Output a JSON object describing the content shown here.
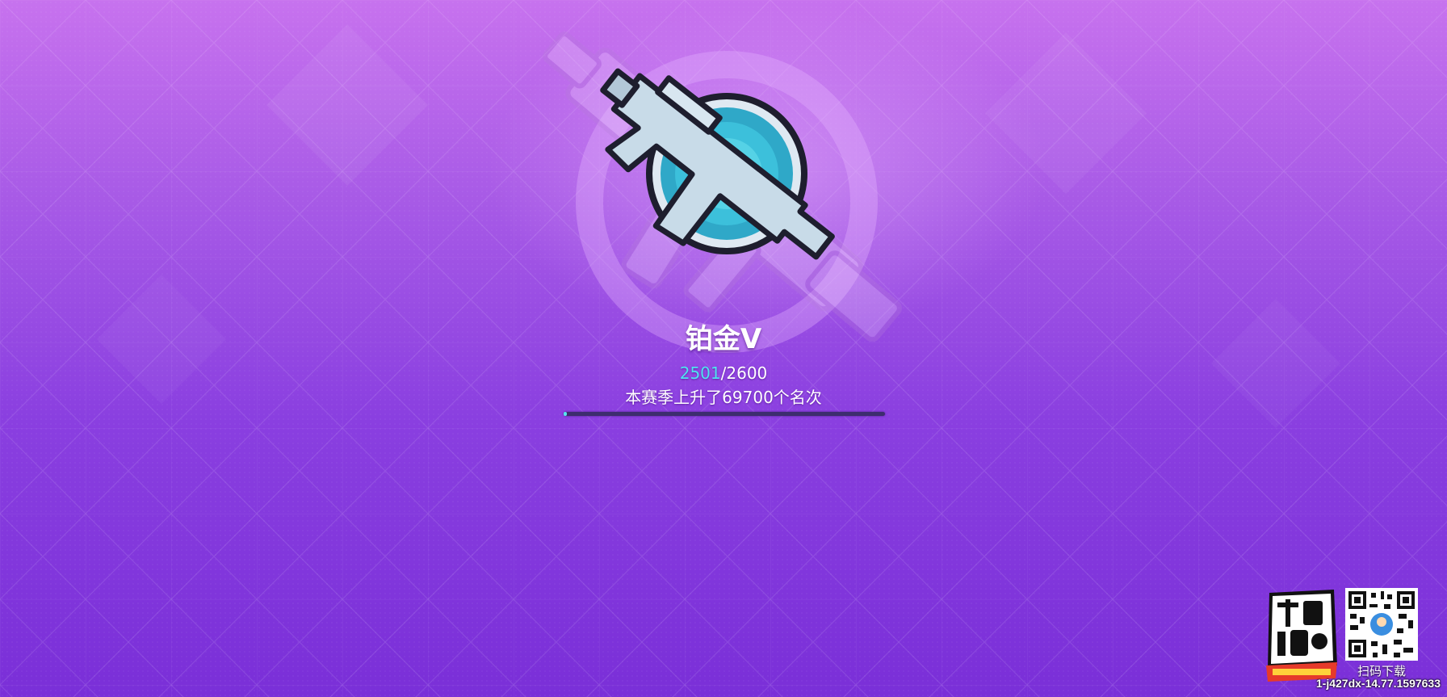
{
  "rank": {
    "name": "铂金V",
    "icon": "smg-rank-badge-icon",
    "score_current": "2501",
    "score_separator": "/",
    "score_max": "2600",
    "season_text": "本赛季上升了69700个名次",
    "progress_fraction": 0.01
  },
  "watermark": {
    "logo_icon": "sausage-man-logo-icon",
    "qr_icon": "qr-code-icon",
    "qr_caption": "扫码下载",
    "build_id": "1-j427dx-14.77.1597633"
  },
  "colors": {
    "background_top": "#c772ee",
    "background_bottom": "#7a2fd8",
    "score_accent": "#4fe3f0",
    "progress_fill": "#58e4f0",
    "progress_track": "#3d2d6e",
    "badge_circle": "#2fa8c8",
    "gun_metal": "#c8dbe8"
  }
}
